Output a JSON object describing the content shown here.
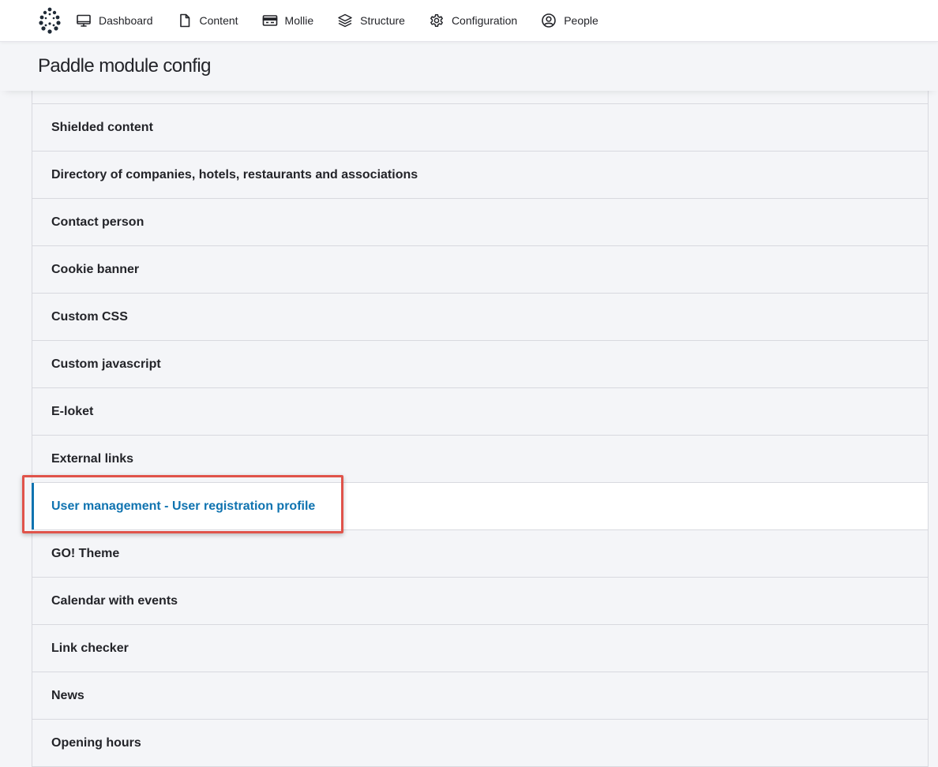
{
  "toolbar": {
    "logo_icon": "paddle-drop-logo",
    "items": [
      {
        "label": "Dashboard",
        "icon": "monitor-icon"
      },
      {
        "label": "Content",
        "icon": "document-icon"
      },
      {
        "label": "Mollie",
        "icon": "credit-card-icon"
      },
      {
        "label": "Structure",
        "icon": "layers-icon"
      },
      {
        "label": "Configuration",
        "icon": "gear-icon"
      },
      {
        "label": "People",
        "icon": "user-circle-icon"
      }
    ]
  },
  "page": {
    "title": "Paddle module config"
  },
  "config_list": {
    "items": [
      {
        "label": "Shielded content"
      },
      {
        "label": "Directory of companies, hotels, restaurants and associations"
      },
      {
        "label": "Contact person"
      },
      {
        "label": "Cookie banner"
      },
      {
        "label": "Custom CSS"
      },
      {
        "label": "Custom javascript"
      },
      {
        "label": "E-loket"
      },
      {
        "label": "External links"
      },
      {
        "label": "User management - User registration profile",
        "active": true
      },
      {
        "label": "GO! Theme"
      },
      {
        "label": "Calendar with events"
      },
      {
        "label": "Link checker"
      },
      {
        "label": "News"
      },
      {
        "label": "Opening hours"
      }
    ]
  },
  "colors": {
    "accent": "#0f73b0",
    "highlight_border": "#e0534a",
    "background": "#f4f5f8"
  }
}
